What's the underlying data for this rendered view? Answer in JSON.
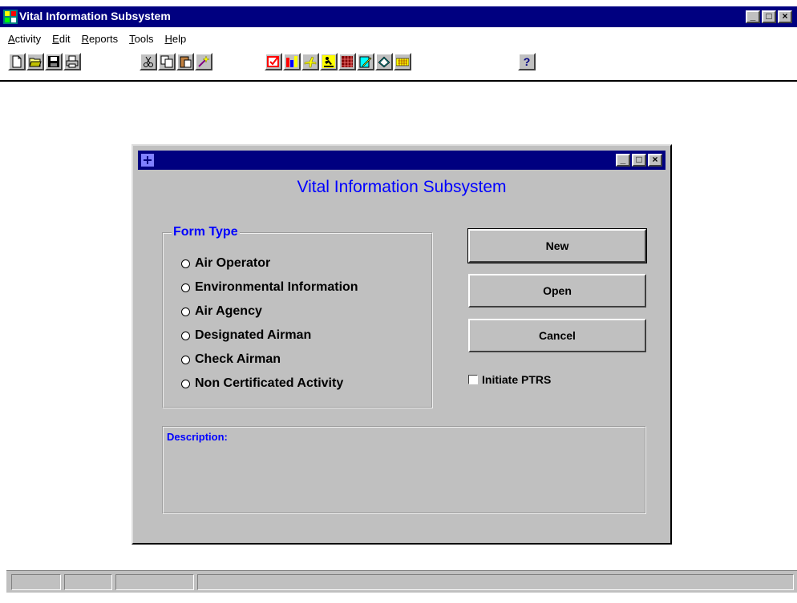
{
  "window": {
    "title": "Vital Information Subsystem",
    "buttons": [
      "_",
      "□",
      "×"
    ]
  },
  "menu": [
    {
      "label": "Activity",
      "underline": "A"
    },
    {
      "label": "Edit",
      "underline": "E"
    },
    {
      "label": "Reports",
      "underline": "R"
    },
    {
      "label": "Tools",
      "underline": "T"
    },
    {
      "label": "Help",
      "underline": "H"
    }
  ],
  "toolbar": {
    "groups": [
      [
        "new-file-icon",
        "open-folder-icon",
        "save-icon",
        "print-icon"
      ],
      [
        "cut-icon",
        "copy-icon",
        "paste-icon",
        "wand-icon"
      ],
      [
        "checklist-icon",
        "bar-chart-icon",
        "airplane-icon",
        "airman-icon",
        "grid-icon",
        "edit-icon",
        "documents-icon",
        "keyboard-icon"
      ],
      [
        "help-icon"
      ]
    ]
  },
  "dialog": {
    "heading": "Vital Information Subsystem",
    "form_type": {
      "legend": "Form Type",
      "options": [
        "Air Operator",
        "Environmental Information",
        "Air Agency",
        "Designated Airman",
        "Check Airman",
        "Non Certificated Activity"
      ]
    },
    "buttons": {
      "new": "New",
      "open": "Open",
      "cancel": "Cancel"
    },
    "initiate_ptrs": {
      "label": "Initiate PTRS",
      "checked": false
    },
    "description_label": "Description:"
  },
  "colors": {
    "titlebar": "#000080",
    "accent_text": "#0000ff",
    "face": "#c0c0c0"
  }
}
